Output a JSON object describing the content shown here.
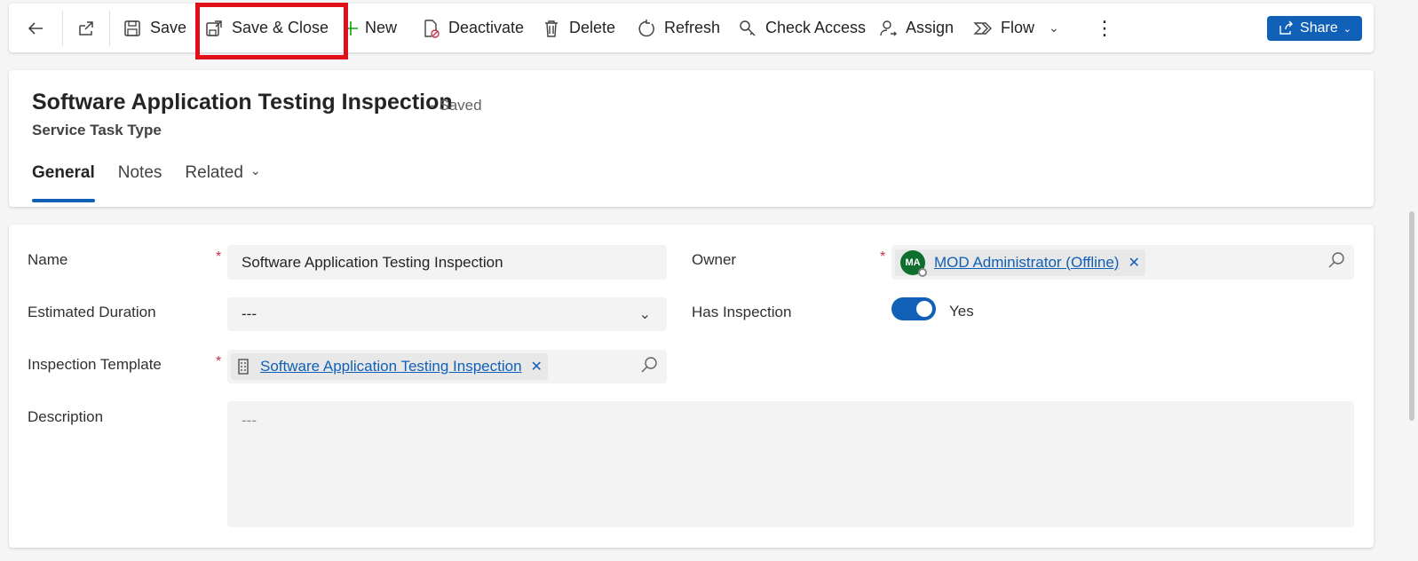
{
  "toolbar": {
    "save": "Save",
    "save_close": "Save & Close",
    "new": "New",
    "deactivate": "Deactivate",
    "delete": "Delete",
    "refresh": "Refresh",
    "check_access": "Check Access",
    "assign": "Assign",
    "flow": "Flow",
    "share": "Share"
  },
  "header": {
    "title": "Software Application Testing Inspection",
    "status": "- Saved",
    "entity": "Service Task Type",
    "tabs": [
      "General",
      "Notes",
      "Related"
    ]
  },
  "form": {
    "name_label": "Name",
    "name_value": "Software Application Testing Inspection",
    "duration_label": "Estimated Duration",
    "duration_value": "---",
    "template_label": "Inspection Template",
    "template_value": "Software Application Testing Inspection",
    "description_label": "Description",
    "description_placeholder": "---",
    "owner_label": "Owner",
    "owner_initials": "MA",
    "owner_value": "MOD Administrator (Offline)",
    "inspection_label": "Has Inspection",
    "inspection_value": "Yes",
    "required_mark": "*"
  },
  "colors": {
    "accent": "#1160b7",
    "highlight": "#e0101a",
    "required": "#c4314b"
  }
}
